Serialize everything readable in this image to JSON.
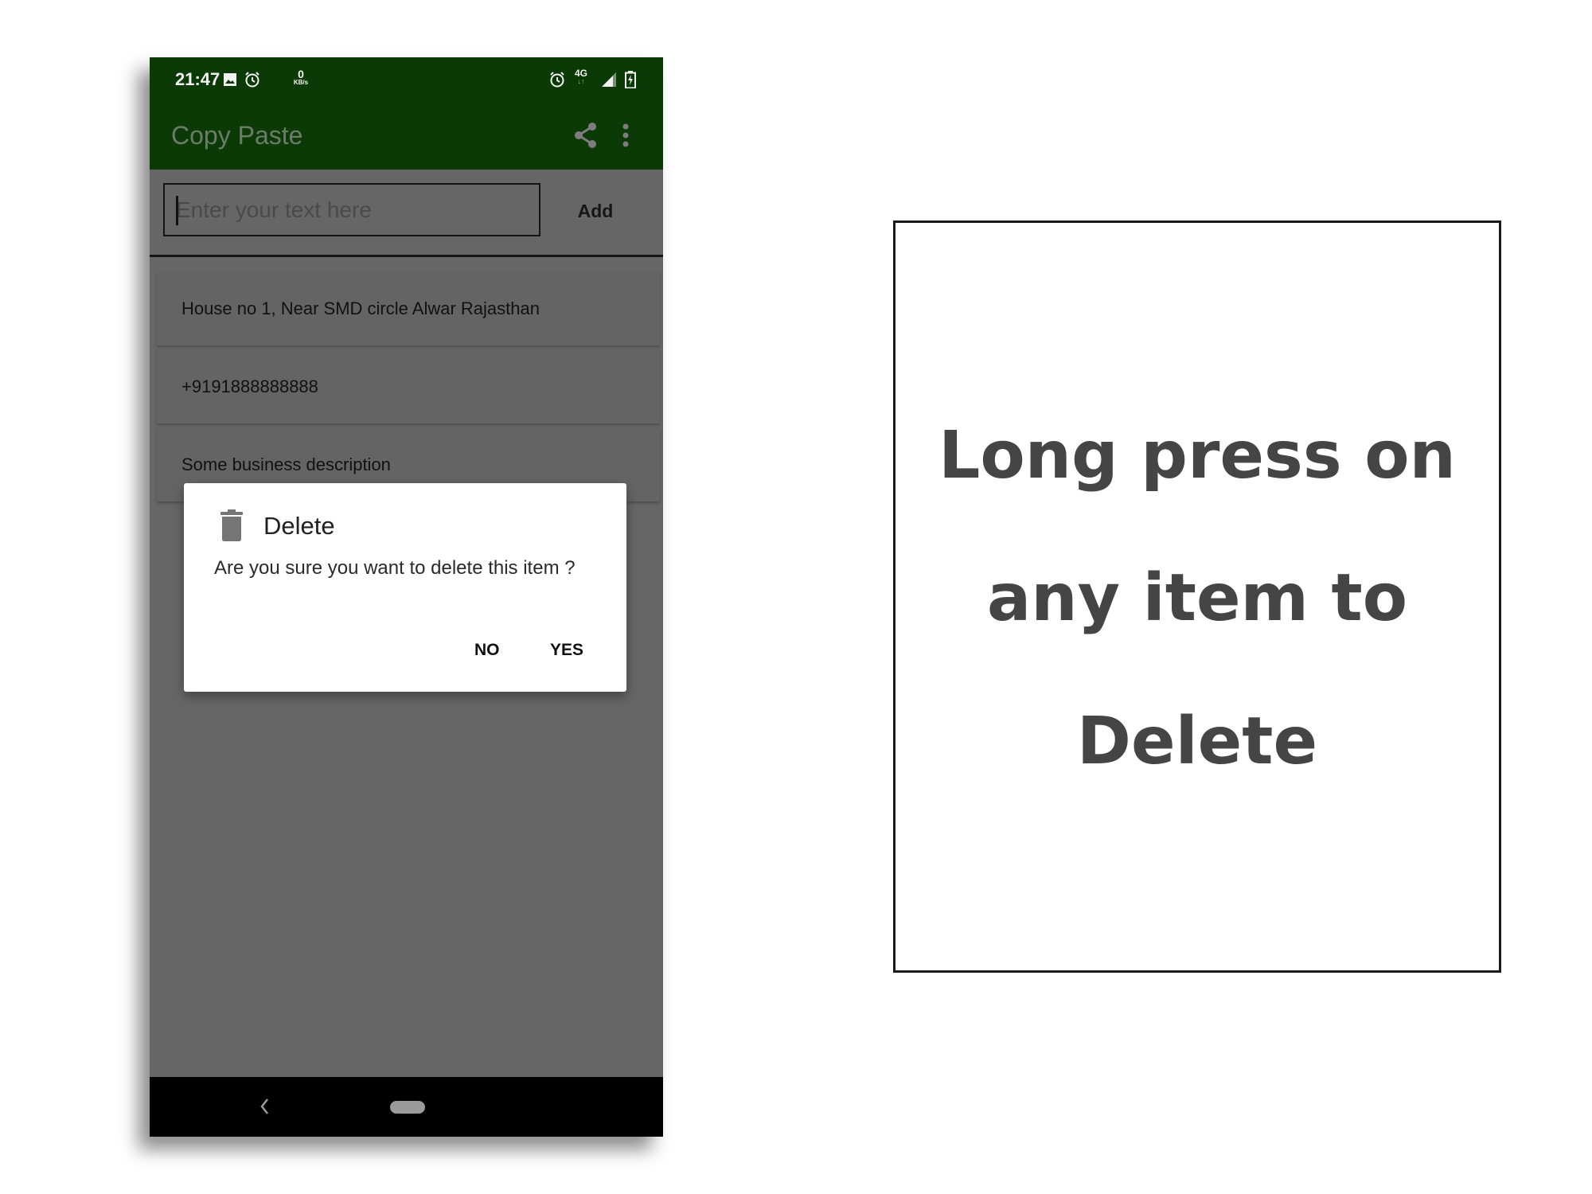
{
  "status_bar": {
    "time": "21:47",
    "left_icons": [
      "image-icon",
      "alarm-icon"
    ],
    "net_speed_value": "0",
    "net_speed_unit": "KB/s",
    "right_icons": [
      "alarm-icon",
      "network-4g-icon",
      "signal-icon",
      "battery-charging-icon"
    ],
    "network_type": "4G",
    "network_arrows": "↓↑"
  },
  "app_bar": {
    "title": "Copy Paste",
    "actions": [
      "share-icon",
      "more-vert-icon"
    ]
  },
  "input_row": {
    "placeholder": "Enter your text here",
    "value": "",
    "add_label": "Add"
  },
  "items": [
    {
      "text": "House no 1, Near SMD circle Alwar Rajasthan"
    },
    {
      "text": "+9191888888888"
    },
    {
      "text": "Some business description"
    }
  ],
  "dialog": {
    "icon": "trash-icon",
    "title": "Delete",
    "message": "Are you sure you want to delete this item ?",
    "no_label": "NO",
    "yes_label": "YES"
  },
  "nav_bar": {
    "back_icon": "‹",
    "home": "home-pill"
  },
  "hint": {
    "lines": [
      "Long press on",
      "any item to",
      "Delete"
    ]
  },
  "colors": {
    "app_bar": "#0b3a06",
    "scrim_bg": "#666666",
    "hint_text": "#454545"
  }
}
